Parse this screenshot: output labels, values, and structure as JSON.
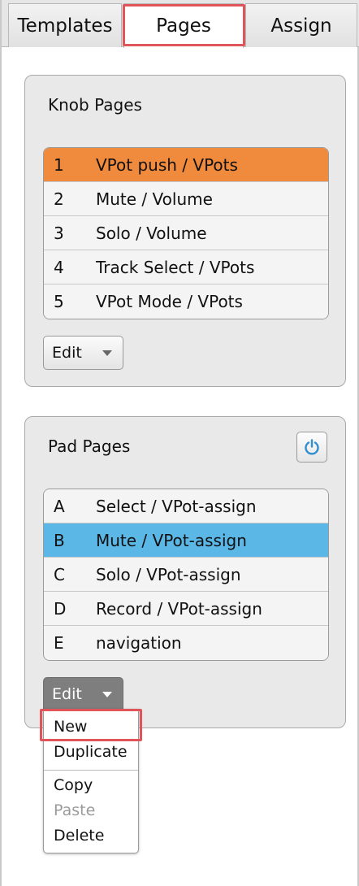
{
  "tabs": [
    {
      "label": "Templates"
    },
    {
      "label": "Pages"
    },
    {
      "label": "Assign"
    }
  ],
  "knob_pages": {
    "title": "Knob Pages",
    "rows": [
      {
        "index": "1",
        "label": "VPot push / VPots",
        "selected": true
      },
      {
        "index": "2",
        "label": "Mute / Volume"
      },
      {
        "index": "3",
        "label": "Solo / Volume"
      },
      {
        "index": "4",
        "label": "Track Select / VPots"
      },
      {
        "index": "5",
        "label": "VPot Mode / VPots"
      }
    ],
    "edit_label": "Edit"
  },
  "pad_pages": {
    "title": "Pad Pages",
    "rows": [
      {
        "index": "A",
        "label": "Select / VPot-assign"
      },
      {
        "index": "B",
        "label": "Mute / VPot-assign",
        "selected": true
      },
      {
        "index": "C",
        "label": "Solo / VPot-assign"
      },
      {
        "index": "D",
        "label": "Record / VPot-assign"
      },
      {
        "index": "E",
        "label": "navigation"
      }
    ],
    "edit_label": "Edit",
    "power_icon": "power-icon"
  },
  "edit_menu": {
    "items": [
      {
        "label": "New"
      },
      {
        "label": "Duplicate"
      },
      {
        "label": "Copy"
      },
      {
        "label": "Paste",
        "disabled": true
      },
      {
        "label": "Delete"
      }
    ]
  },
  "colors": {
    "selected_knob": "#f08a3c",
    "selected_pad": "#5bb7e6",
    "highlight_frame": "#e05559"
  }
}
